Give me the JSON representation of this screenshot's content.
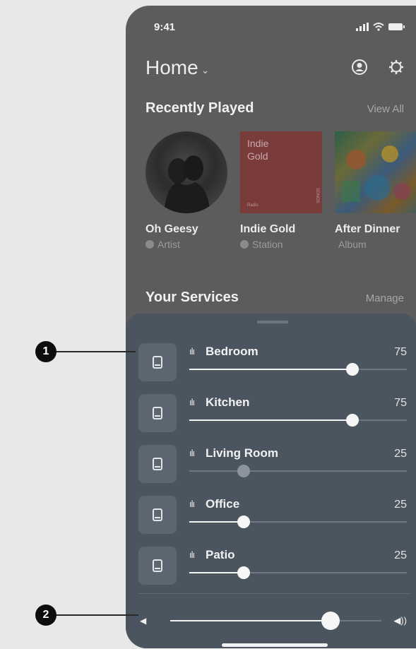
{
  "status_bar": {
    "time": "9:41",
    "icons": [
      "signal-icon",
      "wifi-icon",
      "battery-icon"
    ]
  },
  "header": {
    "title": "Home",
    "icons": [
      "account-icon",
      "settings-icon"
    ]
  },
  "recently_played": {
    "title": "Recently Played",
    "link": "View All",
    "items": [
      {
        "name": "Oh Geesy",
        "type": "Artist",
        "source_icon": "spotify-icon"
      },
      {
        "name": "Indie Gold",
        "type": "Station",
        "source_icon": "station-icon",
        "art_text": "Indie\nGold",
        "art_footer": "Radio",
        "art_side": "SONOS"
      },
      {
        "name": "After Dinner",
        "type": "Album",
        "source_icon": "apple-icon"
      }
    ]
  },
  "services": {
    "title": "Your Services",
    "link": "Manage"
  },
  "rooms": [
    {
      "name": "Bedroom",
      "volume": "75",
      "level": 0.75,
      "active": true
    },
    {
      "name": "Kitchen",
      "volume": "75",
      "level": 0.75,
      "active": true
    },
    {
      "name": "Living Room",
      "volume": "25",
      "level": 0.25,
      "active": false
    },
    {
      "name": "Office",
      "volume": "25",
      "level": 0.25,
      "active": true
    },
    {
      "name": "Patio",
      "volume": "25",
      "level": 0.25,
      "active": true
    }
  ],
  "master_volume": {
    "level": 0.76,
    "low_icon": "volume-low-icon",
    "high_icon": "volume-high-icon"
  },
  "callouts": [
    "1",
    "2"
  ],
  "colors": {
    "sheet": "#4a5560",
    "phone_bg": "#5c5c5c",
    "accent": "#f4f4f4"
  }
}
